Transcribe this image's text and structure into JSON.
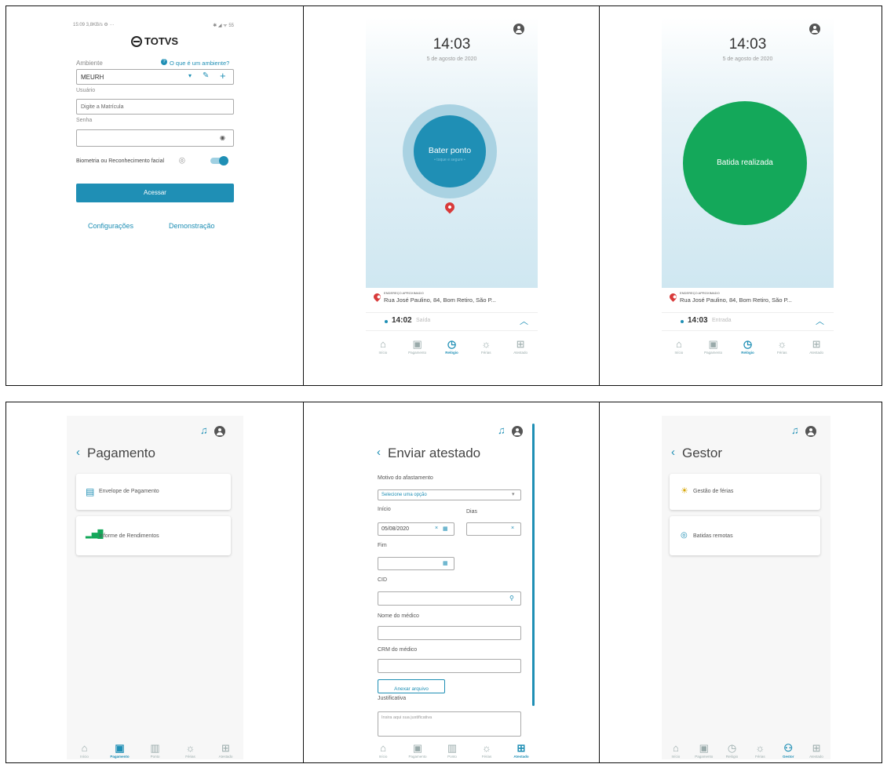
{
  "login": {
    "status_left": "15:09 3,8KB/s ⚙ ···",
    "status_right": "✱ ◢ ᯤ 55",
    "brand": "TOTVS",
    "env_label": "Ambiente",
    "env_help": "O que é um ambiente?",
    "env_value": "MEURH",
    "user_label": "Usuário",
    "user_placeholder": "Digite a Matrícula",
    "pass_label": "Senha",
    "biometric_label": "Biometria ou Reconhecimento facial",
    "access_button": "Acessar",
    "config_link": "Configurações",
    "demo_link": "Demonstração"
  },
  "clock1": {
    "time": "14:03",
    "date": "5 de agosto de 2020",
    "button_title": "Bater ponto",
    "button_sub": "• toque e segure •",
    "addr_caption": "ENDEREÇO APROXIMADO",
    "address": "Rua José Paulino, 84, Bom Retiro, São P...",
    "last_time": "14:02",
    "last_type": "Saída"
  },
  "clock2": {
    "time": "14:03",
    "date": "5 de agosto de 2020",
    "circle_text": "Batida realizada",
    "addr_caption": "ENDEREÇO APROXIMADO",
    "address": "Rua José Paulino, 84, Bom Retiro, São P...",
    "last_time": "14:03",
    "last_type": "Entrada"
  },
  "tabs_a": [
    "Início",
    "Pagamento",
    "Relógio",
    "Férias",
    "Atestado"
  ],
  "tabs_b": [
    "Início",
    "Pagamento",
    "Ponto",
    "Férias",
    "Atestado"
  ],
  "tabs_c": [
    "Início",
    "Pagamento",
    "Relógio",
    "Férias",
    "Gestor",
    "Atestado"
  ],
  "payment": {
    "title": "Pagamento",
    "items": [
      "Envelope de Pagamento",
      "Informe de Rendimentos"
    ]
  },
  "atestado": {
    "title": "Enviar atestado",
    "motivo_label": "Motivo do afastamento",
    "motivo_placeholder": "Selecione uma opção",
    "inicio_label": "Início",
    "dias_label": "Dias",
    "inicio_value": "05/08/2020",
    "fim_label": "Fim",
    "cid_label": "CID",
    "medico_label": "Nome do médico",
    "crm_label": "CRM do médico",
    "anexar_button": "Anexar arquivo",
    "justificativa_label": "Justificativa",
    "justificativa_placeholder": "Insira aqui sua justificativa"
  },
  "gestor": {
    "title": "Gestor",
    "items": [
      "Gestão de férias",
      "Batidas remotas"
    ]
  },
  "colors": {
    "primary": "#1f8fb5",
    "success": "#14a85a",
    "sky": "#cfe7f1",
    "pin": "#d83a3a"
  }
}
